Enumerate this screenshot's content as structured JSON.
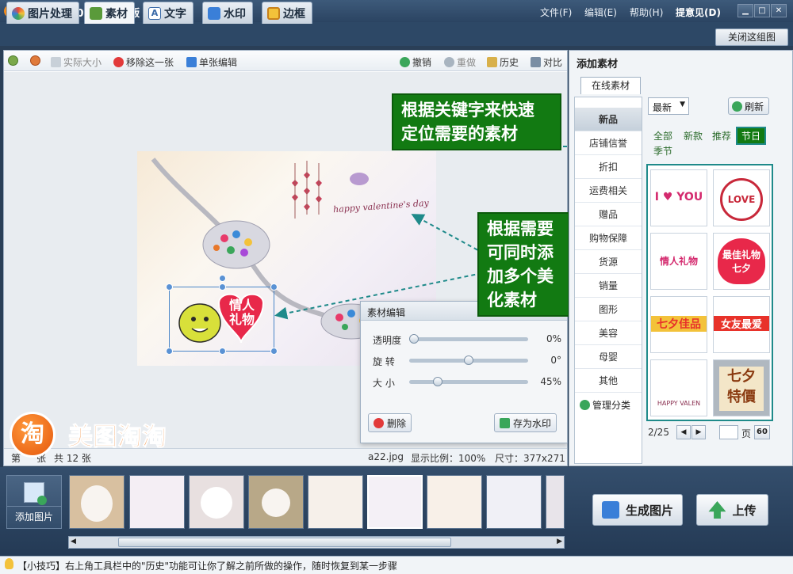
{
  "title_bar": {
    "app_title": "美图淘淘 1.0.5 淘宝专版",
    "logo_glyph": "淘",
    "menu": [
      "文件(F)",
      "编辑(E)",
      "帮助(H)",
      "提意见(D)"
    ],
    "window_controls": [
      "▁",
      "□",
      "✕"
    ]
  },
  "tabs": {
    "items": [
      {
        "label": "图片处理",
        "icon": "photo-edit-icon"
      },
      {
        "label": "素材",
        "icon": "material-icon"
      },
      {
        "label": "文字",
        "icon": "text-icon"
      },
      {
        "label": "水印",
        "icon": "watermark-icon"
      },
      {
        "label": "边框",
        "icon": "frame-icon"
      }
    ],
    "active": "素材",
    "close_group": "关闭这组图"
  },
  "toolbar": {
    "actual_size": "实际大小",
    "remove_one": "移除这一张",
    "single_edit": "单张编辑",
    "undo": "撤销",
    "redo": "重做",
    "history": "历史",
    "compare": "对比"
  },
  "canvas": {
    "valentine_text": "happy valentine's day",
    "sticker_text": "情人\n礼物"
  },
  "editor": {
    "title": "素材编辑",
    "opacity_label": "透明度",
    "opacity_value": "0%",
    "opacity": 0.0,
    "rotate_label": "旋  转",
    "rotate_value": "0°",
    "rotate": 0.5,
    "size_label": "大  小",
    "size_value": "45%",
    "size": 0.22,
    "delete_btn": "删除",
    "save_watermark_btn": "存为水印"
  },
  "status": {
    "page_prefix": "第",
    "page_suffix": "张",
    "total": "共 12 张",
    "filename": "a22.jpg",
    "zoom": "显示比例：100%",
    "dimensions": "尺寸：377x271"
  },
  "callouts": {
    "keyword": "根据关键字来快速\n定位需要的素材",
    "multiple": "根据需要\n可同时添\n加多个美\n化素材"
  },
  "brand": {
    "logo_glyph": "淘",
    "text": "美图淘淘"
  },
  "right_panel": {
    "title": "添加素材",
    "tab": "在线素材",
    "categories": [
      "新品",
      "店铺信誉",
      "折扣",
      "运费相关",
      "赠品",
      "购物保障",
      "货源",
      "销量",
      "图形",
      "美容",
      "母婴",
      "其他"
    ],
    "active_category": "新品",
    "manage": "管理分类",
    "sort": "最新",
    "refresh": "刷新",
    "filters": [
      "全部",
      "新款",
      "推荐",
      "节日",
      "季节"
    ],
    "active_filter": "节日",
    "thumbs": [
      {
        "text": "I ♥ YOU",
        "color": "#d42a6e"
      },
      {
        "text": "LOVE",
        "color": "#c8283a"
      },
      {
        "text": "情人礼物",
        "color": "#d42a6e"
      },
      {
        "text": "最佳礼物\n七夕",
        "color": "#ffffff"
      },
      {
        "text": "七夕佳品",
        "color": "#e8322a"
      },
      {
        "text": "女友最爱",
        "color": "#e8322a"
      },
      {
        "text": "HAPPY VALEN",
        "color": "#8a3050"
      },
      {
        "text": "七夕\n特價",
        "color": "#8a3a10"
      }
    ],
    "pager": {
      "current": "2/25",
      "page_label": "页",
      "go": "60"
    }
  },
  "bottom": {
    "add_image": "添加图片",
    "generate": "生成图片",
    "upload": "上传"
  },
  "tip": "【小技巧】右上角工具栏中的\"历史\"功能可让你了解之前所做的操作，随时恢复到某一步骤",
  "colors": {
    "callout_bg": "#127a12",
    "accent_teal": "#1f8a8a",
    "brand_orange": "#f07a1c",
    "titlebar": "#2b4462"
  }
}
